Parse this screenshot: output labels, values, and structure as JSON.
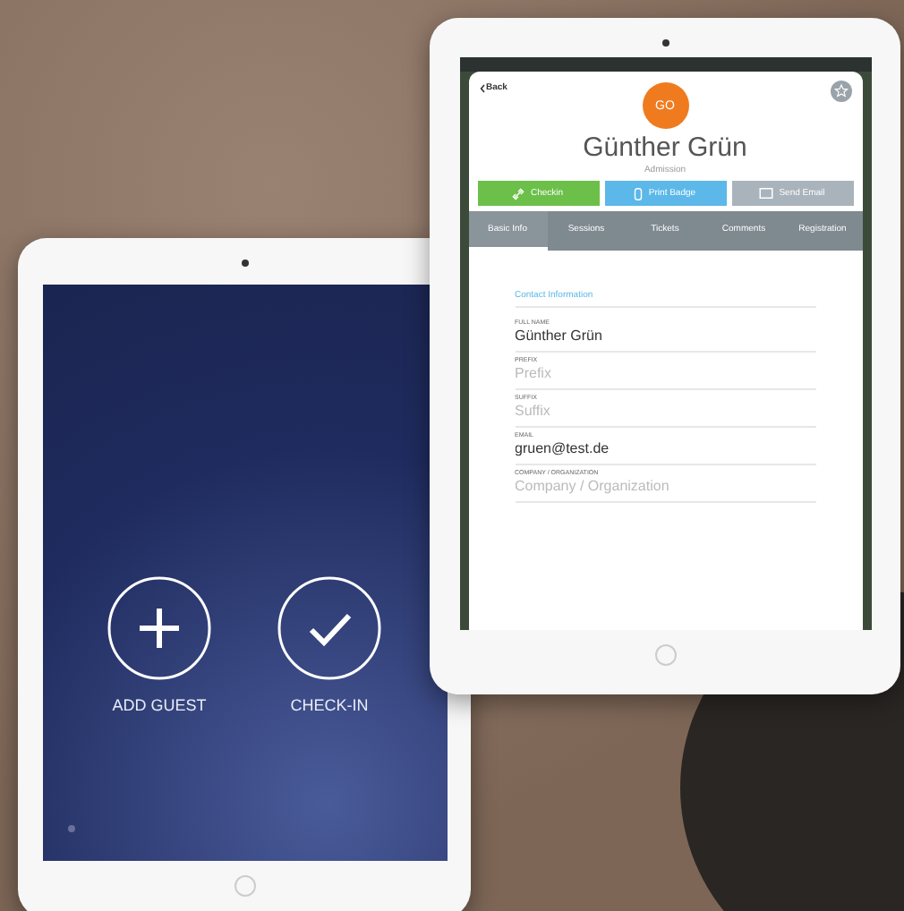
{
  "left_tablet": {
    "actions": [
      {
        "kind": "add",
        "label": "ADD GUEST"
      },
      {
        "kind": "check",
        "label": "CHECK-IN"
      }
    ]
  },
  "right_tablet": {
    "back": "Back",
    "avatar": "GO",
    "name": "Günther Grün",
    "role": "Admission",
    "buttons": [
      {
        "kind": "checkin",
        "label": "Checkin",
        "color": "#6cc04a"
      },
      {
        "kind": "badge",
        "label": "Print Badge",
        "color": "#5bb8e8"
      },
      {
        "kind": "mail",
        "label": "Send Email",
        "color": "#a9b3bb"
      }
    ],
    "tabs": [
      {
        "label": "Basic Info",
        "selected": true
      },
      {
        "label": "Sessions",
        "selected": false
      },
      {
        "label": "Tickets",
        "selected": false
      },
      {
        "label": "Comments",
        "selected": false
      },
      {
        "label": "Registration",
        "selected": false
      }
    ],
    "section": "Contact Information",
    "fields": [
      {
        "label": "FULL NAME",
        "value": "Günther Grün"
      },
      {
        "label": "PREFIX",
        "placeholder": "Prefix"
      },
      {
        "label": "SUFFIX",
        "placeholder": "Suffix"
      },
      {
        "label": "EMAIL",
        "value": "gruen@test.de"
      },
      {
        "label": "COMPANY / ORGANIZATION",
        "placeholder": "Company / Organization"
      }
    ]
  }
}
